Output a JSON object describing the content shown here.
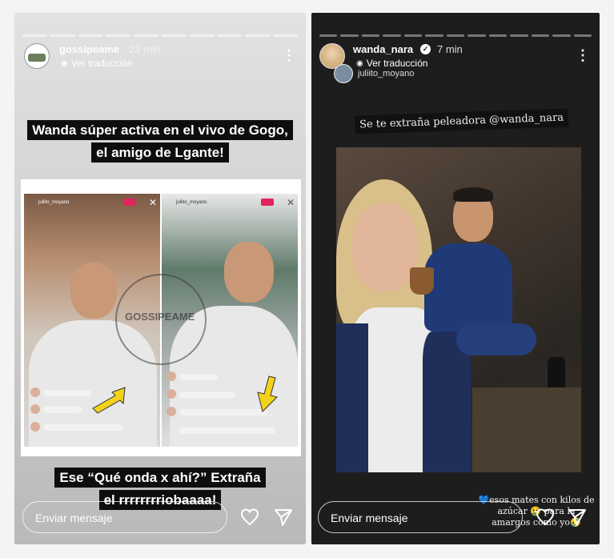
{
  "left_story": {
    "username": "gossipeame",
    "time": "23 min",
    "translate_label": "Ver traducción",
    "caption_top": [
      "Wanda súper activa en el vivo de Gogo,",
      "el amigo de Lgante!"
    ],
    "caption_bottom": [
      "Ese “Qué onda x ahí?” Extraña",
      "el rrrrrrrriobaaaa!"
    ],
    "watermark": "GOSSIPEAME",
    "live_header_name": "juliito_moyano",
    "message_placeholder": "Enviar mensaje"
  },
  "right_story": {
    "username": "wanda_nara",
    "time": "7 min",
    "translate_label": "Ver traducción",
    "tagged_user": "juliito_moyano",
    "caption_top": "Se te extraña peleadora @wanda_nara",
    "caption_bottom": [
      "💙esos mates con kilos de",
      "azúcar 🤮 para la",
      "amargos como yo🤣"
    ],
    "message_placeholder": "Enviar mensaje"
  }
}
